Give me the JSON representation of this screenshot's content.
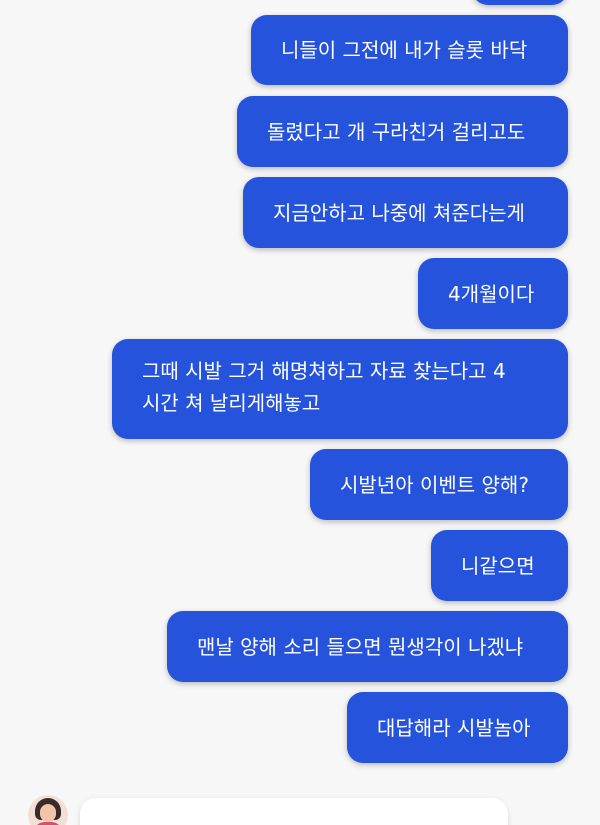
{
  "messages": [
    {
      "text": ""
    },
    {
      "text": "니들이 그전에 내가 슬롯 바닥"
    },
    {
      "text": "돌렸다고 개 구라친거 걸리고도"
    },
    {
      "text": "지금안하고 나중에 쳐준다는게"
    },
    {
      "text": "4개월이다"
    },
    {
      "text": "그때 시발 그거 해명쳐하고 자료 찾는다고 4 시간 쳐 날리게해놓고"
    },
    {
      "text": "시발년아 이벤트 양해?"
    },
    {
      "text": "니같으면"
    },
    {
      "text": "맨날 양해 소리 들으면 뭔생각이 나겠냐"
    },
    {
      "text": "대답해라 시발놈아"
    }
  ],
  "incoming": {
    "text": "",
    "avatar_icon": "woman-avatar-icon"
  },
  "colors": {
    "outgoing_bubble": "#2553dc",
    "background": "#f7f7f7",
    "incoming_bubble": "#ffffff"
  }
}
